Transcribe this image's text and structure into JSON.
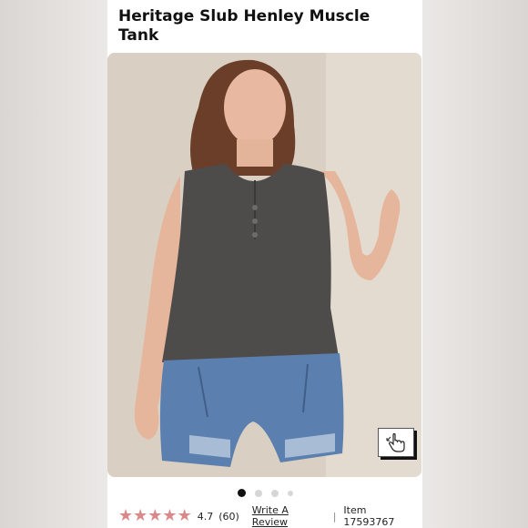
{
  "product": {
    "title": "Heritage Slub Henley Muscle Tank"
  },
  "gallery": {
    "slide_count": 4,
    "active_slide": 1,
    "zoom_icon": "pointer-hand-zoom-icon"
  },
  "reviews": {
    "stars_filled": 5,
    "star_icon": "star-icon",
    "star_color": "#d9898a",
    "rating": "4.7",
    "count": "(60)",
    "write_review_label": "Write A Review",
    "separator": "|",
    "item_number": "Item 17593767"
  }
}
